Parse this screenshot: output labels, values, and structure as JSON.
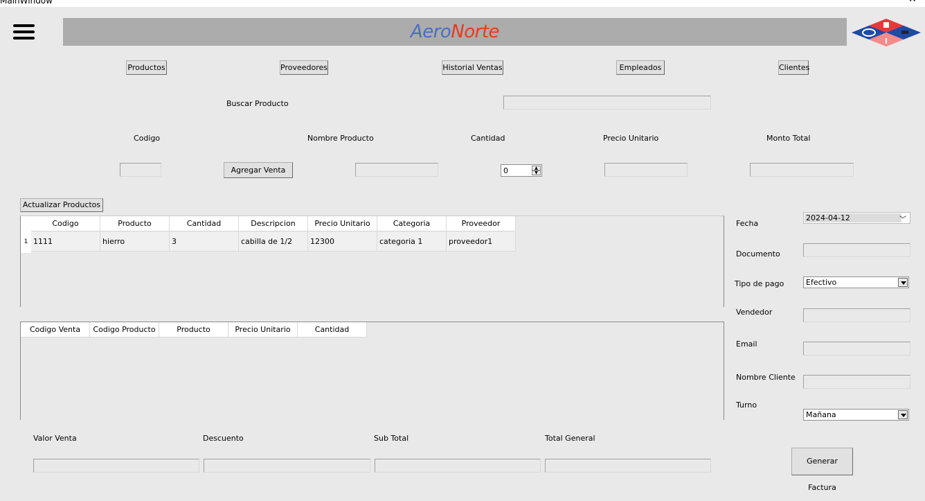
{
  "window": {
    "title": "MainWindow",
    "minimize": "–",
    "close": "✕"
  },
  "brand": {
    "part1": "Aero",
    "part2": "Norte"
  },
  "colors": {
    "banner": "#acacac",
    "brand_blue": "#4a6dc0",
    "brand_red": "#e8391d"
  },
  "nav": [
    "Productos",
    "Proveedores",
    "Historial Ventas",
    "Empleados",
    "Clientes"
  ],
  "search": {
    "label": "Buscar Producto",
    "value": ""
  },
  "form": {
    "codigo_label": "Codigo",
    "nombre_label": "Nombre Producto",
    "cantidad_label": "Cantidad",
    "precio_label": "Precio Unitario",
    "monto_label": "Monto Total",
    "agregar_button": "Agregar Venta",
    "cantidad_value": "0"
  },
  "actualizar_button": "Actualizar Productos",
  "products_table": {
    "headers": [
      "Codigo",
      "Producto",
      "Cantidad",
      "Descripcion",
      "Precio Unitario",
      "Categoria",
      "Proveedor"
    ],
    "rows": [
      {
        "num": "1",
        "cells": [
          "1111",
          "hierro",
          "3",
          "cabilla de 1/2",
          "12300",
          "categoria 1",
          "proveedor1"
        ]
      }
    ]
  },
  "sales_table": {
    "headers": [
      "Codigo Venta",
      "Codigo Producto",
      "Producto",
      "Precio Unitario",
      "Cantidad"
    ]
  },
  "side": {
    "fecha_label": "Fecha",
    "fecha_value": "2024-04-12",
    "documento_label": "Documento",
    "tipo_pago_label": "Tipo de pago",
    "tipo_pago_value": "Efectivo",
    "vendedor_label": "Vendedor",
    "email_label": "Email",
    "nombre_cliente_label": "Nombre Cliente",
    "turno_label": "Turno",
    "turno_value": "Mañana"
  },
  "totals": {
    "valor_venta_label": "Valor Venta",
    "descuento_label": "Descuento",
    "sub_total_label": "Sub Total",
    "total_general_label": "Total General"
  },
  "generar_button": "Generar Factura"
}
